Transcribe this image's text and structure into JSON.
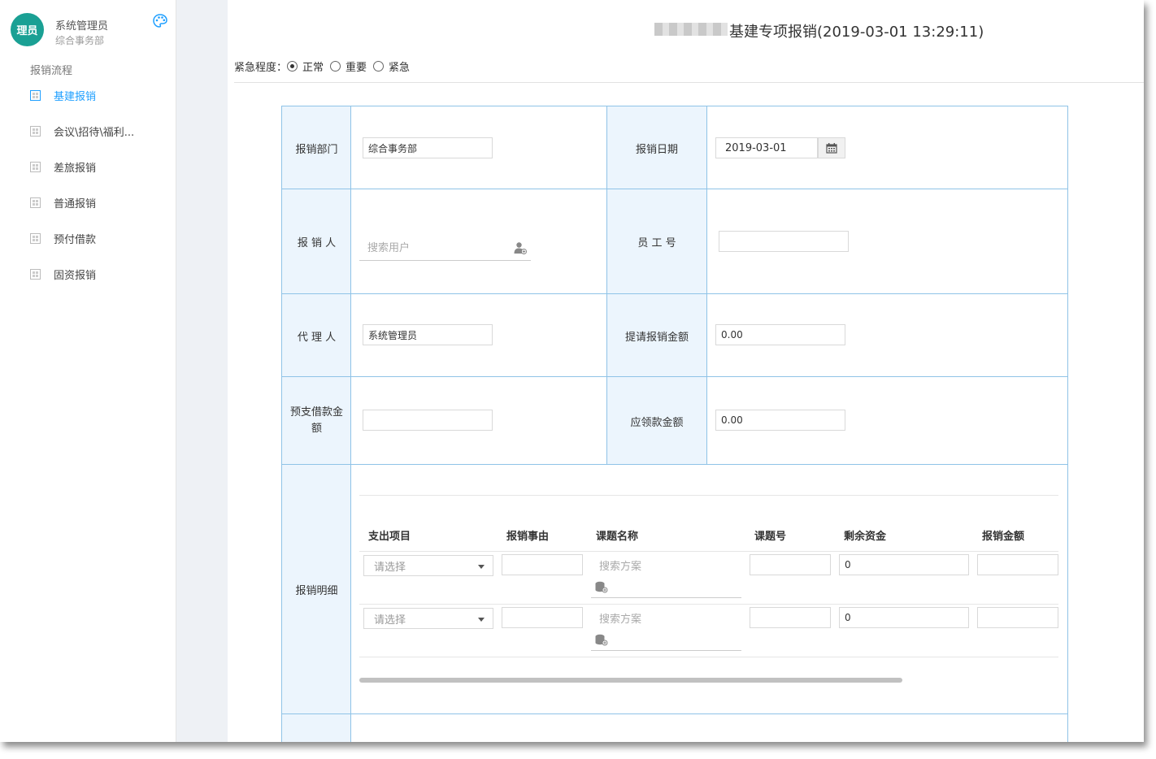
{
  "sidebar": {
    "avatar_text": "理员",
    "user_name": "系统管理员",
    "user_dept": "综合事务部",
    "palette_icon": "palette-icon",
    "menu_title": "报销流程",
    "items": [
      {
        "label": "基建报销",
        "active": true
      },
      {
        "label": "会议\\招待\\福利...",
        "active": false
      },
      {
        "label": "差旅报销",
        "active": false
      },
      {
        "label": "普通报销",
        "active": false
      },
      {
        "label": "预付借款",
        "active": false
      },
      {
        "label": "固资报销",
        "active": false
      }
    ]
  },
  "header": {
    "title": "基建专项报销(2019-03-01 13:29:11)",
    "urgency_label": "紧急程度：",
    "urgency_options": [
      {
        "label": "正常",
        "checked": true
      },
      {
        "label": "重要",
        "checked": false
      },
      {
        "label": "紧急",
        "checked": false
      }
    ]
  },
  "form": {
    "dept_label": "报销部门",
    "dept_value": "综合事务部",
    "date_label": "报销日期",
    "date_value": "2019-03-01",
    "claimant_label": "报 销 人",
    "claimant_placeholder": "搜索用户",
    "employee_no_label": "员 工 号",
    "employee_no_value": "",
    "agent_label": "代 理 人",
    "agent_value": "系统管理员",
    "request_amount_label": "提请报销金额",
    "request_amount_value": "0.00",
    "advance_label": "预支借款金额",
    "advance_value": "",
    "receivable_label": "应领款金额",
    "receivable_value": "0.00",
    "details_label": "报销明细"
  },
  "details": {
    "columns": [
      "支出项目",
      "报销事由",
      "课题名称",
      "课题号",
      "剩余资金",
      "报销金额"
    ],
    "rows": [
      {
        "item_placeholder": "请选择",
        "reason": "",
        "project_placeholder": "搜索方案",
        "project_no": "",
        "remaining": "0",
        "amount": ""
      },
      {
        "item_placeholder": "请选择",
        "reason": "",
        "project_placeholder": "搜索方案",
        "project_no": "",
        "remaining": "0",
        "amount": ""
      }
    ]
  },
  "colors": {
    "accent": "#1e9fff",
    "avatar_bg": "#1aa094",
    "label_bg": "#ecf5fd",
    "border": "#8fc3e7"
  }
}
